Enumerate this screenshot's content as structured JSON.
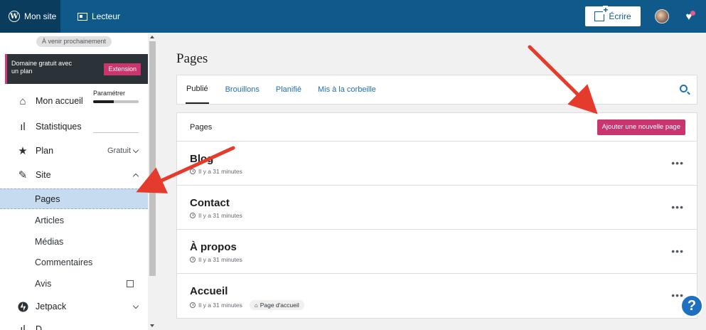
{
  "topbar": {
    "site_label": "Mon site",
    "reader_label": "Lecteur",
    "write_label": "Écrire"
  },
  "sidebar": {
    "soon_label": "À venir prochainement",
    "promo": {
      "text": "Domaine gratuit avec un plan",
      "button": "Extension"
    },
    "items": [
      {
        "label": "Mon accueil",
        "extra": "Paramétrer",
        "progress": 0.45
      },
      {
        "label": "Statistiques"
      },
      {
        "label": "Plan",
        "extra": "Gratuit"
      },
      {
        "label": "Site"
      }
    ],
    "subitems": [
      "Pages",
      "Articles",
      "Médias",
      "Commentaires",
      "Avis"
    ],
    "bottom_items": [
      {
        "label": "Jetpack"
      },
      {
        "label": "D..."
      }
    ]
  },
  "main": {
    "title": "Pages",
    "tabs": [
      "Publié",
      "Brouillons",
      "Planifié",
      "Mis à la corbeille"
    ],
    "list_header": "Pages",
    "add_button": "Ajouter une nouvelle page",
    "rows": [
      {
        "title": "Blog",
        "meta": "Il y a 31 minutes",
        "badge": ""
      },
      {
        "title": "Contact",
        "meta": "Il y a 31 minutes",
        "badge": ""
      },
      {
        "title": "À propos",
        "meta": "Il y a 31 minutes",
        "badge": ""
      },
      {
        "title": "Accueil",
        "meta": "Il y a 31 minutes",
        "badge": "Page d'accueil"
      }
    ]
  },
  "help_label": "?",
  "colors": {
    "topbar": "#0f5a8a",
    "accent_pink": "#c9356e",
    "link_blue": "#2271b1",
    "annotation_arrow": "#e53b2c"
  }
}
